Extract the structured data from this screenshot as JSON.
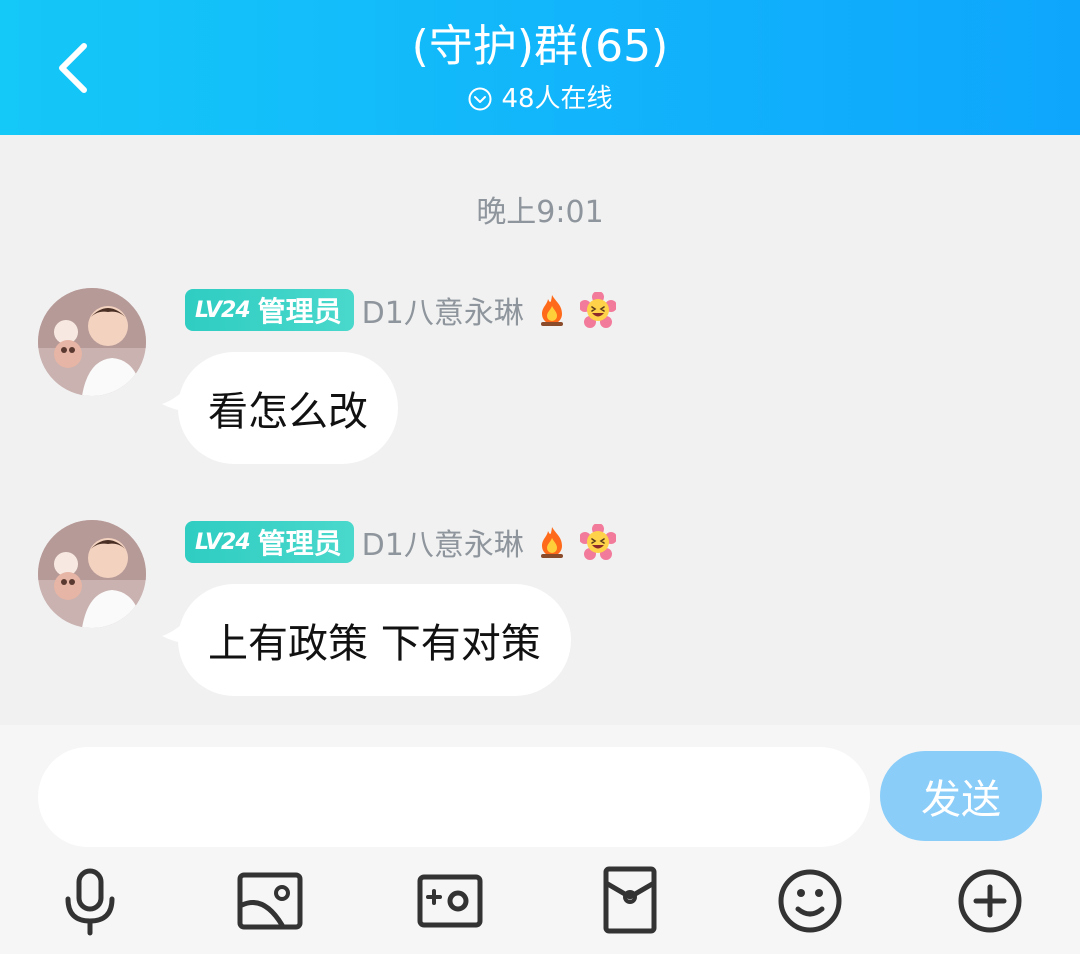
{
  "header": {
    "title": "(守护)群(65)",
    "online_text": "48人在线",
    "back_icon": "back-arrow-icon",
    "online_icon": "chevron-down-circle-icon",
    "color": "#12b4fb"
  },
  "chat": {
    "timestamp": "晚上9:01",
    "messages": [
      {
        "level": "LV24",
        "role": "管理员",
        "sender": "D1八意永琳",
        "emojis": [
          "fire-icon",
          "laughing-flower-icon"
        ],
        "text": "看怎么改"
      },
      {
        "level": "LV24",
        "role": "管理员",
        "sender": "D1八意永琳",
        "emojis": [
          "fire-icon",
          "laughing-flower-icon"
        ],
        "text": "上有政策 下有对策"
      }
    ]
  },
  "composer": {
    "input_value": "",
    "send_label": "发送",
    "send_color": "#8acdf9",
    "tools": [
      "microphone-icon",
      "image-icon",
      "camera-icon",
      "red-packet-icon",
      "emoji-icon",
      "plus-icon"
    ]
  }
}
